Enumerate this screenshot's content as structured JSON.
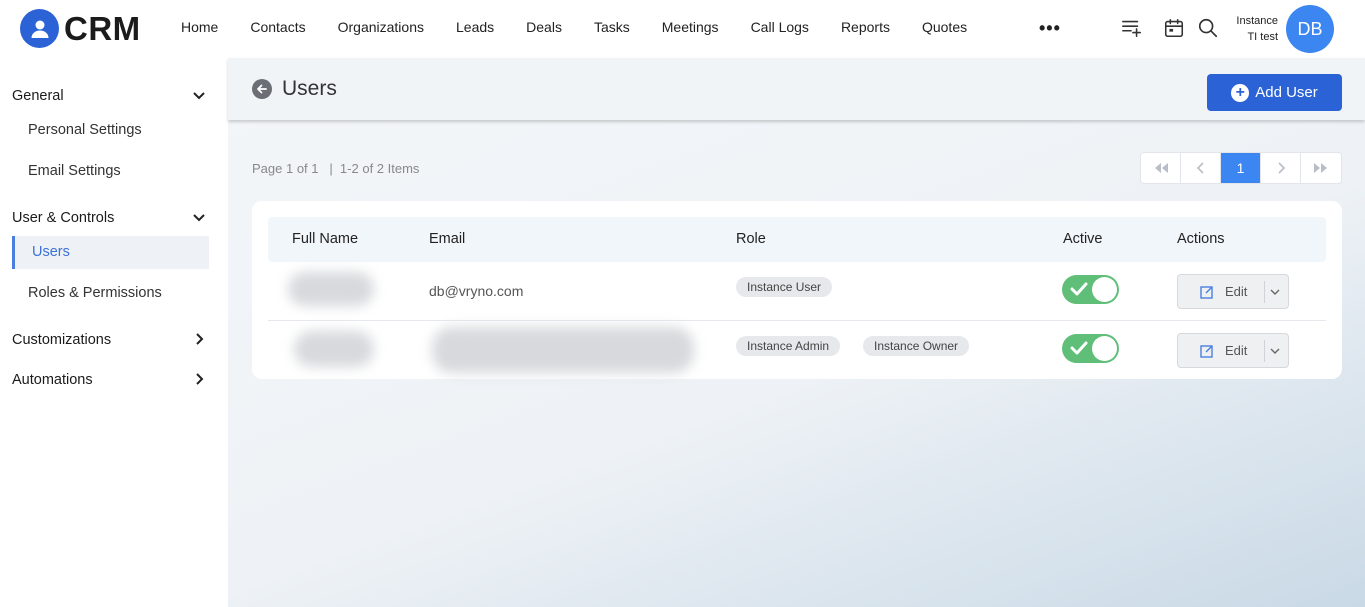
{
  "app": {
    "logo_text": "CRM"
  },
  "nav": {
    "items": [
      "Home",
      "Contacts",
      "Organizations",
      "Leads",
      "Deals",
      "Tasks",
      "Meetings",
      "Call Logs",
      "Reports",
      "Quotes"
    ],
    "more": "•••"
  },
  "user": {
    "line1": "Instance",
    "line2": "TI test",
    "initials": "DB"
  },
  "sidebar": {
    "general": "General",
    "personal_settings": "Personal Settings",
    "email_settings": "Email Settings",
    "user_controls": "User & Controls",
    "users": "Users",
    "roles_permissions": "Roles & Permissions",
    "customizations": "Customizations",
    "automations": "Automations"
  },
  "page": {
    "title": "Users",
    "add_button": "Add User",
    "page_info": "Page 1 of 1   |  1-2 of 2 Items",
    "current_page": "1"
  },
  "table": {
    "headers": {
      "full_name": "Full Name",
      "email": "Email",
      "role": "Role",
      "active": "Active",
      "actions": "Actions"
    },
    "rows": [
      {
        "email": "db@vryno.com",
        "roles": [
          "Instance User"
        ],
        "active": true,
        "action": "Edit"
      },
      {
        "email": "",
        "roles": [
          "Instance Admin",
          "Instance Owner"
        ],
        "active": true,
        "action": "Edit"
      }
    ]
  },
  "colors": {
    "primary": "#2b63d6",
    "avatar": "#3b86f0",
    "toggle_on": "#5fbf78"
  }
}
